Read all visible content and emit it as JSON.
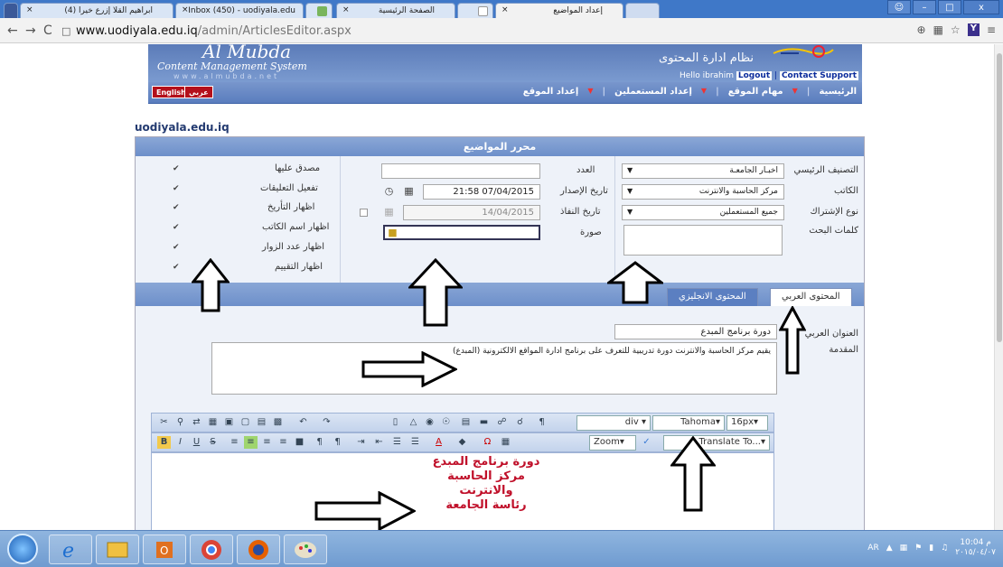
{
  "browser": {
    "tabs": [
      {
        "label": "ابراهيم القلا إزرع خيرا (4)",
        "active": false
      },
      {
        "label": "Inbox (450) - uodiyala.edu",
        "active": false
      },
      {
        "label": "",
        "active": false
      },
      {
        "label": "الصفحة الرئيسية",
        "active": false
      },
      {
        "label": "",
        "active": false
      },
      {
        "label": "إعداد المواضيع",
        "active": true
      }
    ],
    "url_host": "www.uodiyala.edu.iq",
    "url_path": "/admin/ArticlesEditor.aspx"
  },
  "header": {
    "logo_line1": "Al Mubda",
    "logo_line2": "Content Management System",
    "logo_line3": "www.almubda.net",
    "cms_arabic": "نظام ادارة المحتوى",
    "hello": "Hello ibrahim",
    "logout": "Logout",
    "contact": "Contact Support"
  },
  "menu": {
    "lang_en": "English",
    "lang_ar": "عربي",
    "items": [
      "الرئيسية",
      "مهام الموقع",
      "إعداد المستعملين",
      "إعداد الموقع"
    ]
  },
  "site_name": "uodiyala.edu.iq",
  "editor": {
    "title": "محرر المواضيع",
    "main_category_label": "التصنيف الرئيسي",
    "main_category_value": "اخبـار الجامعـة",
    "author_label": "الكاتب",
    "author_value": "مركز الحاسبة والانترنت",
    "subscription_label": "نوع الإشتراك",
    "subscription_value": "جميع المستعملين",
    "keywords_label": "كلمات البحث",
    "number_label": "العدد",
    "issue_date_label": "تاريخ الإصدار",
    "issue_date_value": "21:58 07/04/2015",
    "expiry_date_label": "تاريخ النفاذ",
    "expiry_date_value": "14/04/2015",
    "image_label": "صورة",
    "checks": [
      {
        "label": "مصدق عليها",
        "checked": true
      },
      {
        "label": "تفعيل التعليقات",
        "checked": true
      },
      {
        "label": "اظهار التأريخ",
        "checked": true
      },
      {
        "label": "اظهار اسم الكاتب",
        "checked": true
      },
      {
        "label": "اظهار عدد الزوار",
        "checked": true
      },
      {
        "label": "اظهار التقييم",
        "checked": true
      }
    ],
    "tab_arabic": "المحتوى العربي",
    "tab_english": "المحتوى الانجليزي",
    "title_ar_label": "العنوان العربي",
    "title_ar_value": "دورة برنامج المبدع",
    "intro_label": "المقدمة",
    "intro_value": "يقيم مركز الحاسبة والانترنت دورة تدريبية للتعرف على برنامج ادارة المواقع الالكترونية (المبدع)",
    "toolbar": {
      "format": "div",
      "font": "Tahoma",
      "size": "16px",
      "zoom": "Zoom",
      "translate": "Translate To..."
    },
    "body_lines": [
      "دورة برنامج المبدع",
      "مركز الحاسبة والانترنت",
      "رئاسة الجامعة"
    ]
  },
  "taskbar": {
    "lang": "AR",
    "time": "10:04 م",
    "date": "٢٠١٥/٠٤/٠٧"
  }
}
